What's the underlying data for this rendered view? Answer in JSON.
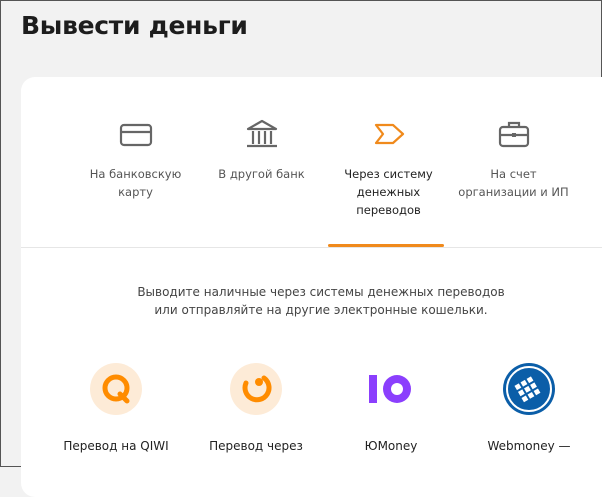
{
  "page": {
    "title": "Вывести деньги"
  },
  "tabs": [
    {
      "label": "На банковскую карту",
      "icon": "bank-card-icon"
    },
    {
      "label": "В другой банк",
      "icon": "bank-building-icon"
    },
    {
      "label": "Через систему денежных переводов",
      "icon": "transfer-arrow-icon",
      "active": true
    },
    {
      "label": "На счет организации и ИП",
      "icon": "briefcase-icon"
    }
  ],
  "description": {
    "line1": "Выводите наличные через системы денежных переводов",
    "line2": "или отправляйте на другие электронные кошельки."
  },
  "methods": [
    {
      "label": "Перевод на QIWI",
      "icon": "qiwi-logo-icon"
    },
    {
      "label": "Перевод через",
      "icon": "contact-logo-icon"
    },
    {
      "label": "ЮMoney",
      "icon": "yoomoney-logo-icon",
      "logo_text": "Ю"
    },
    {
      "label": "Webmoney —",
      "icon": "webmoney-logo-icon"
    }
  ],
  "colors": {
    "accent": "#f08a1c",
    "yoomoney": "#8b3ffd",
    "webmoney": "#0b5ea8",
    "qiwi": "#ff8c00"
  }
}
